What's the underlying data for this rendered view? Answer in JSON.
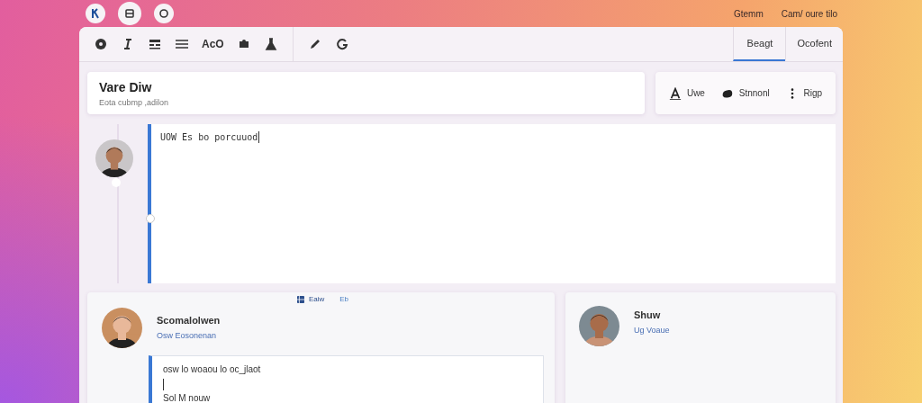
{
  "top_links": [
    "Gtemm",
    "Cam/ oure tilo"
  ],
  "toolbar": {
    "label": "AcO"
  },
  "tabs": [
    {
      "label": "Beagt",
      "selected": true
    },
    {
      "label": "Ocofent",
      "selected": false
    }
  ],
  "header_card": {
    "title": "Vare Diw",
    "subtitle": "Eota cubmp ,adilon"
  },
  "actions": [
    "Uwe",
    "Stnnonl",
    "Rigp"
  ],
  "editor": {
    "value": "UOW Es bo porcuuod"
  },
  "posts": [
    {
      "meta": "Eaiw",
      "meta_badge": "Eb",
      "name": "Scomalolwen",
      "handle": "Osw Eosonenan",
      "reply_lines": [
        "osw lo woaou lo oc_jlaot",
        "Sol M nouw"
      ]
    },
    {
      "name": "Shuw",
      "handle": "Ug Voaue"
    }
  ]
}
